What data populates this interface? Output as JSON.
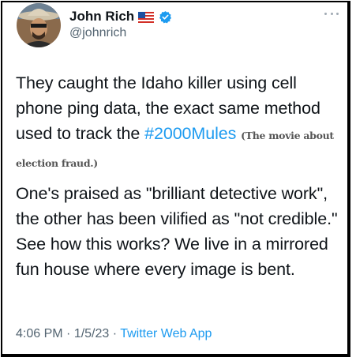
{
  "author": {
    "display_name": "John Rich",
    "handle": "@johnrich",
    "flag_icon": "us-flag-icon",
    "verified_icon": "verified-badge-icon",
    "verified_color": "#1d9bf0"
  },
  "tweet": {
    "p1_before": "They caught the Idaho killer using cell phone ping data, the exact same method used to track the ",
    "hashtag": "#2000Mules",
    "annotation": "(The movie about election fraud.)",
    "p2": "One's praised as \"brilliant detective work\", the other has been vilified as \"not credible.\" See how this works? We live in a mirrored fun house where every image is bent."
  },
  "meta": {
    "time": "4:06 PM",
    "sep1": " · ",
    "date": "1/5/23",
    "sep2": " · ",
    "app": "Twitter Web App"
  },
  "colors": {
    "text": "#0f1419",
    "secondary": "#536471",
    "link": "#1d9bf0"
  }
}
